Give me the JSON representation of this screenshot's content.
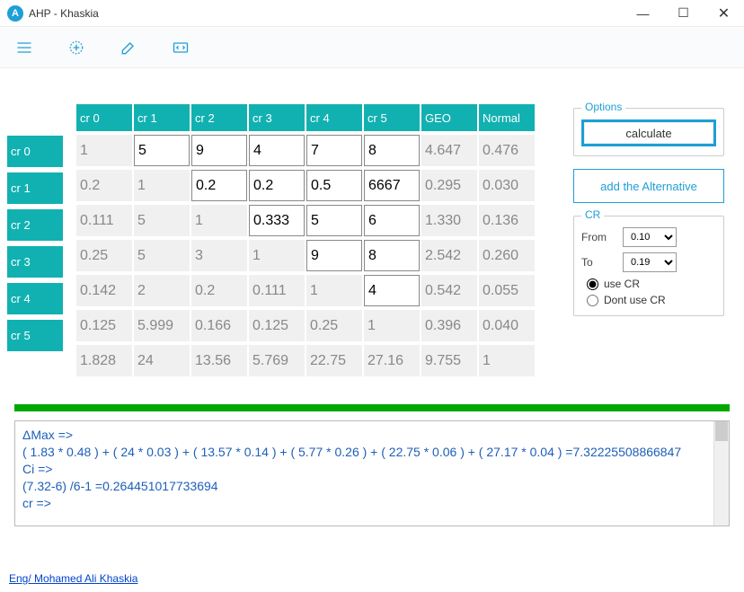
{
  "window": {
    "title": "AHP - Khaskia"
  },
  "headers": [
    "cr 0",
    "cr 1",
    "cr 2",
    "cr 3",
    "cr 4",
    "cr 5",
    "GEO",
    "Normal"
  ],
  "rowLabels": [
    "cr 0",
    "cr 1",
    "cr 2",
    "cr 3",
    "cr 4",
    "cr 5"
  ],
  "grid": [
    [
      {
        "v": "1",
        "e": false
      },
      {
        "v": "5",
        "e": true
      },
      {
        "v": "9",
        "e": true
      },
      {
        "v": "4",
        "e": true
      },
      {
        "v": "7",
        "e": true
      },
      {
        "v": "8",
        "e": true
      },
      {
        "v": "4.647",
        "e": false
      },
      {
        "v": "0.476",
        "e": false
      }
    ],
    [
      {
        "v": "0.2",
        "e": false
      },
      {
        "v": "1",
        "e": false
      },
      {
        "v": "0.2",
        "e": true
      },
      {
        "v": "0.2",
        "e": true
      },
      {
        "v": "0.5",
        "e": true
      },
      {
        "v": "6667",
        "e": true
      },
      {
        "v": "0.295",
        "e": false
      },
      {
        "v": "0.030",
        "e": false
      }
    ],
    [
      {
        "v": "0.111",
        "e": false
      },
      {
        "v": "5",
        "e": false
      },
      {
        "v": "1",
        "e": false
      },
      {
        "v": "0.333",
        "e": true
      },
      {
        "v": "5",
        "e": true
      },
      {
        "v": "6",
        "e": true
      },
      {
        "v": "1.330",
        "e": false
      },
      {
        "v": "0.136",
        "e": false
      }
    ],
    [
      {
        "v": "0.25",
        "e": false
      },
      {
        "v": "5",
        "e": false
      },
      {
        "v": "3",
        "e": false
      },
      {
        "v": "1",
        "e": false
      },
      {
        "v": "9",
        "e": true
      },
      {
        "v": "8",
        "e": true
      },
      {
        "v": "2.542",
        "e": false
      },
      {
        "v": "0.260",
        "e": false
      }
    ],
    [
      {
        "v": "0.142",
        "e": false
      },
      {
        "v": "2",
        "e": false
      },
      {
        "v": "0.2",
        "e": false
      },
      {
        "v": "0.111",
        "e": false
      },
      {
        "v": "1",
        "e": false
      },
      {
        "v": "4",
        "e": true
      },
      {
        "v": "0.542",
        "e": false
      },
      {
        "v": "0.055",
        "e": false
      }
    ],
    [
      {
        "v": "0.125",
        "e": false
      },
      {
        "v": "5.999",
        "e": false
      },
      {
        "v": "0.166",
        "e": false
      },
      {
        "v": "0.125",
        "e": false
      },
      {
        "v": "0.25",
        "e": false
      },
      {
        "v": "1",
        "e": false
      },
      {
        "v": "0.396",
        "e": false
      },
      {
        "v": "0.040",
        "e": false
      }
    ],
    [
      {
        "v": "1.828",
        "e": false
      },
      {
        "v": "24",
        "e": false
      },
      {
        "v": "13.56",
        "e": false
      },
      {
        "v": "5.769",
        "e": false
      },
      {
        "v": "22.75",
        "e": false
      },
      {
        "v": "27.16",
        "e": false
      },
      {
        "v": "9.755",
        "e": false
      },
      {
        "v": "1",
        "e": false
      }
    ]
  ],
  "options": {
    "legend": "Options",
    "calculate": "calculate",
    "addAlt": "add the Alternative",
    "crLegend": "CR",
    "fromLabel": "From",
    "fromVal": "0.10",
    "toLabel": "To",
    "toVal": "0.19",
    "useCR": "use CR",
    "dontUseCR": "Dont use CR"
  },
  "output": {
    "l1": "ΔMax =>",
    "l2": "( 1.83 * 0.48 )  + ( 24 * 0.03 )  + ( 13.57 * 0.14 )  + ( 5.77 * 0.26 )  + ( 22.75 * 0.06 )  + ( 27.17 * 0.04 )  =7.32225508866847",
    "l3": "Ci =>",
    "l4": "(7.32-6) /6-1 =0.264451017733694",
    "l5": "cr =>"
  },
  "footer": "Eng/ Mohamed Ali Khaskia"
}
